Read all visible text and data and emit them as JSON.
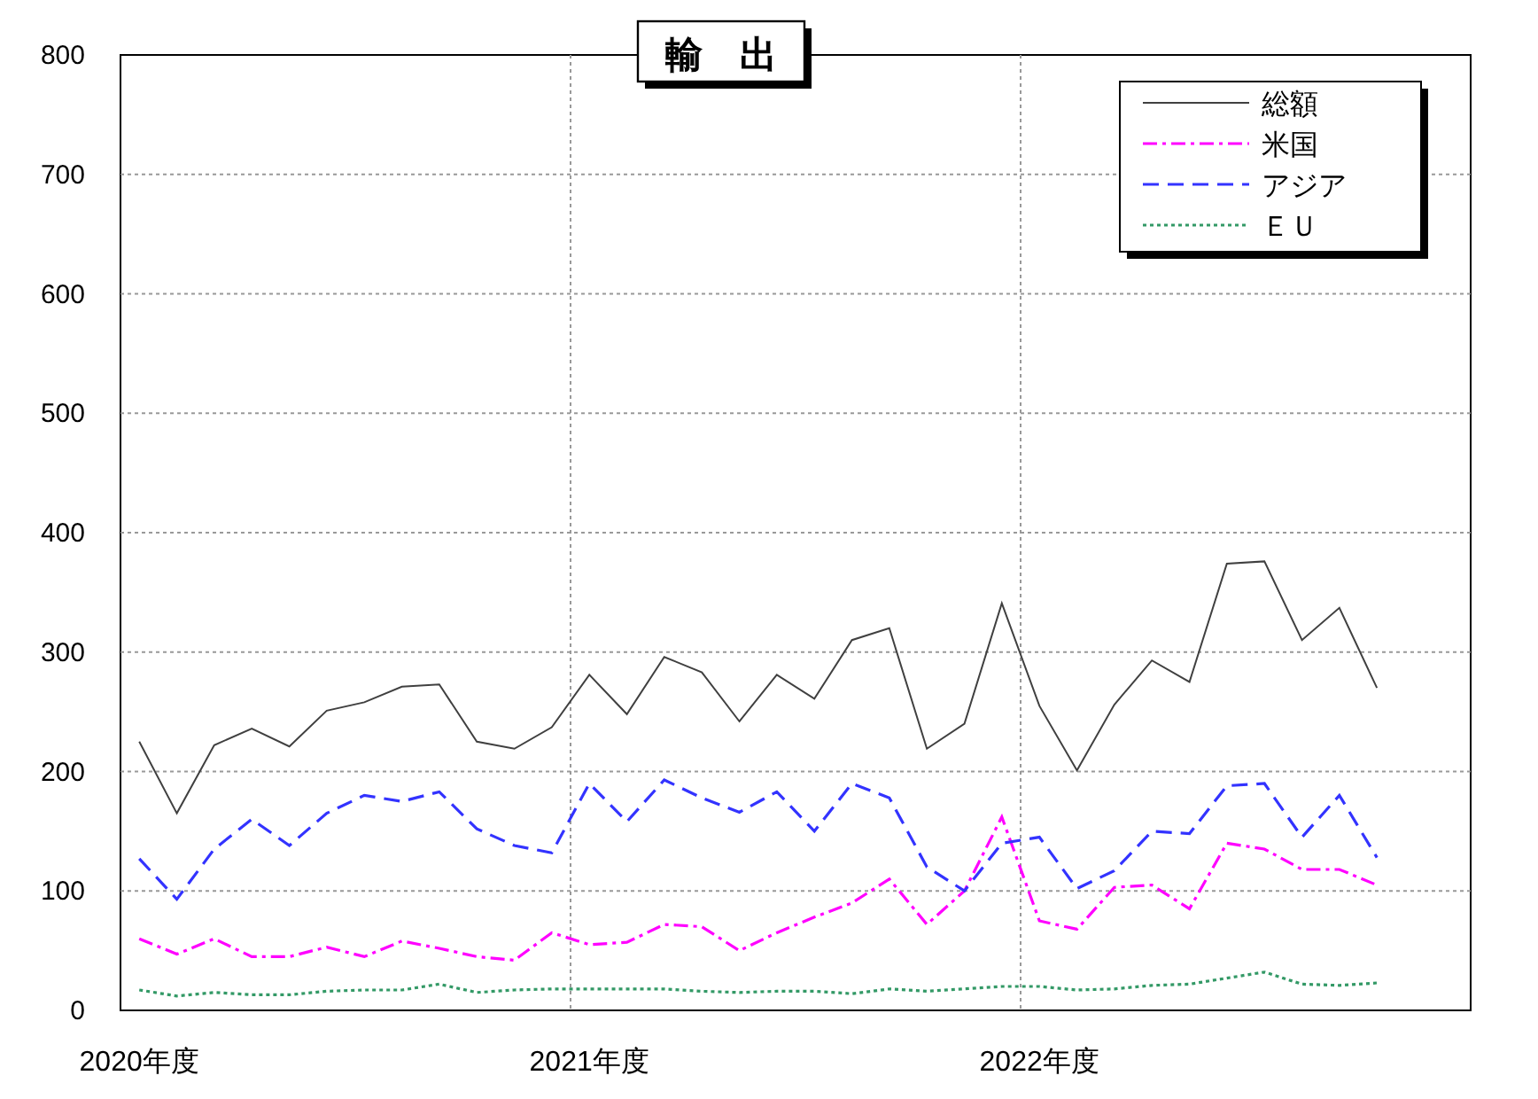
{
  "chart": {
    "chart_data": {
      "type": "line",
      "title": "輸　出",
      "categories": [
        "2020年度",
        null,
        null,
        null,
        null,
        null,
        null,
        null,
        null,
        null,
        null,
        null,
        "2021年度",
        null,
        null,
        null,
        null,
        null,
        null,
        null,
        null,
        null,
        null,
        null,
        "2022年度",
        null,
        null,
        null,
        null,
        null,
        null,
        null,
        null,
        null
      ],
      "ylim": [
        0,
        800
      ],
      "grid": true,
      "legend": true,
      "yticks": [
        0,
        100,
        200,
        300,
        400,
        500,
        600,
        700,
        800
      ],
      "series": [
        {
          "name": "総額",
          "color": "#404040",
          "line_style": "solid",
          "values": [
            225,
            165,
            222,
            236,
            221,
            251,
            258,
            271,
            273,
            225,
            219,
            237,
            281,
            248,
            296,
            283,
            242,
            281,
            261,
            310,
            320,
            219,
            240,
            341,
            255,
            201,
            256,
            293,
            275,
            374,
            376,
            310,
            337,
            270
          ]
        },
        {
          "name": "米国",
          "color": "#ff00ff",
          "line_style": "dashdot",
          "values": [
            60,
            47,
            60,
            45,
            45,
            53,
            45,
            58,
            52,
            45,
            42,
            65,
            55,
            57,
            72,
            70,
            50,
            65,
            78,
            90,
            110,
            72,
            100,
            162,
            75,
            68,
            103,
            105,
            85,
            140,
            135,
            118,
            118,
            105
          ]
        },
        {
          "name": "アジア",
          "color": "#3333ff",
          "line_style": "dash",
          "values": [
            127,
            93,
            135,
            160,
            138,
            165,
            180,
            175,
            183,
            152,
            138,
            132,
            190,
            158,
            193,
            178,
            166,
            183,
            150,
            190,
            178,
            120,
            100,
            140,
            145,
            102,
            117,
            150,
            148,
            188,
            190,
            145,
            180,
            128
          ]
        },
        {
          "name": "ＥＵ",
          "color": "#339966",
          "line_style": "dot",
          "values": [
            17,
            12,
            15,
            13,
            13,
            16,
            17,
            17,
            22,
            15,
            17,
            18,
            18,
            18,
            18,
            16,
            15,
            16,
            16,
            14,
            18,
            16,
            18,
            20,
            20,
            17,
            18,
            21,
            22,
            27,
            32,
            22,
            21,
            23
          ]
        }
      ]
    }
  }
}
